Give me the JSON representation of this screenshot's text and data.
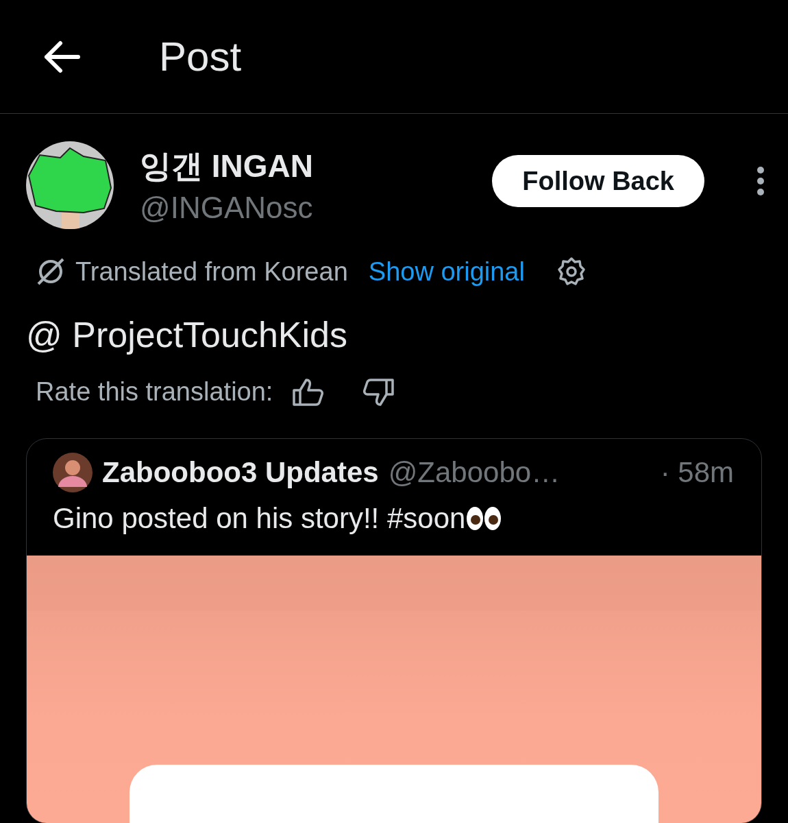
{
  "header": {
    "title": "Post"
  },
  "post": {
    "author": {
      "name": "잉갠 INGAN",
      "handle": "@INGANosc"
    },
    "follow_button": "Follow Back",
    "translation": {
      "label": "Translated from Korean",
      "link": "Show original"
    },
    "text": "@ ProjectTouchKids",
    "rating": {
      "label": "Rate this translation:"
    },
    "quote": {
      "name": "Zabooboo3 Updates",
      "handle": "@Zaboobo…",
      "time": "· 58m",
      "text": "Gino posted on his story!! #soon"
    }
  }
}
